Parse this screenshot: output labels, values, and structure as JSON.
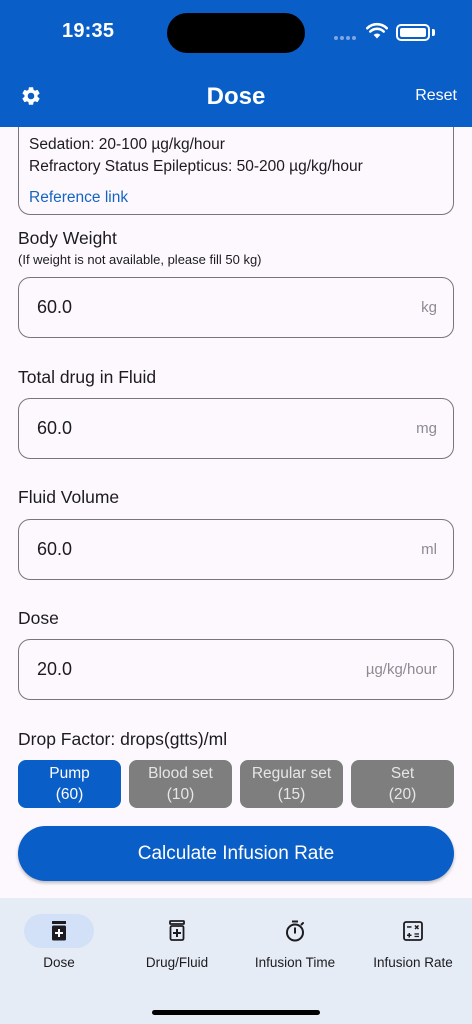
{
  "status_bar": {
    "time": "19:35"
  },
  "app_bar": {
    "title": "Dose",
    "reset_label": "Reset"
  },
  "info_card": {
    "lines": [
      "Sedation: 20-100 µg/kg/hour",
      "Refractory Status Epilepticus: 50-200 µg/kg/hour"
    ],
    "link_label": "Reference link"
  },
  "fields": {
    "body_weight": {
      "label": "Body Weight",
      "sublabel": "(If weight is not available, please fill 50 kg)",
      "value": "60.0",
      "unit": "kg"
    },
    "total_drug": {
      "label": "Total drug in Fluid",
      "value": "60.0",
      "unit": "mg"
    },
    "fluid_volume": {
      "label": "Fluid Volume",
      "value": "60.0",
      "unit": "ml"
    },
    "dose": {
      "label": "Dose",
      "value": "20.0",
      "unit": "µg/kg/hour"
    }
  },
  "drop_factor": {
    "label": "Drop Factor: drops(gtts)/ml",
    "options": [
      {
        "name": "Pump",
        "value": "(60)",
        "selected": true
      },
      {
        "name": "Blood set",
        "value": "(10)",
        "selected": false
      },
      {
        "name": "Regular set",
        "value": "(15)",
        "selected": false
      },
      {
        "name": "Set",
        "value": "(20)",
        "selected": false
      }
    ]
  },
  "calculate_label": "Calculate Infusion Rate",
  "bottom_nav": {
    "items": [
      {
        "label": "Dose",
        "icon": "medication-bottle-icon",
        "active": true
      },
      {
        "label": "Drug/Fluid",
        "icon": "medication-bottle-icon",
        "active": false
      },
      {
        "label": "Infusion Time",
        "icon": "timer-icon",
        "active": false
      },
      {
        "label": "Infusion Rate",
        "icon": "calculator-icon",
        "active": false
      }
    ]
  },
  "colors": {
    "primary": "#0a5ec7",
    "chip_inactive": "#7e7e7e",
    "nav_background": "#e6ecf5",
    "link": "#1565c0"
  }
}
